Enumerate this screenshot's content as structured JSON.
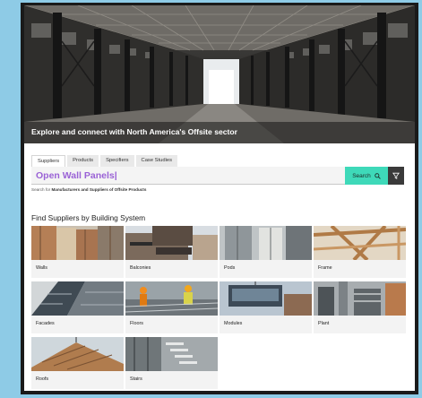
{
  "hero": {
    "title": "Explore and connect with North America's Offsite sector"
  },
  "tabs": [
    {
      "label": "Suppliers",
      "active": true
    },
    {
      "label": "Products",
      "active": false
    },
    {
      "label": "Specifiers",
      "active": false
    },
    {
      "label": "Case Studies",
      "active": false
    }
  ],
  "search": {
    "value": "Open Wall Panels|",
    "button_label": "Search",
    "search_icon": "search-icon",
    "filter_icon": "filter-icon"
  },
  "hint": {
    "prefix": "Search for ",
    "bold": "Manufacturers and Suppliers of Offsite Products"
  },
  "section_title": "Find Suppliers by Building System",
  "categories": [
    {
      "label": "Walls"
    },
    {
      "label": "Balconies"
    },
    {
      "label": "Pods"
    },
    {
      "label": "Frame"
    },
    {
      "label": "Facades"
    },
    {
      "label": "Floors"
    },
    {
      "label": "Modules"
    },
    {
      "label": "Plant"
    },
    {
      "label": "Roofs"
    },
    {
      "label": "Stairs"
    }
  ],
  "colors": {
    "accent": "#3ed9b9",
    "search_text": "#9a62d6",
    "page_bg": "#8ecbe6"
  }
}
